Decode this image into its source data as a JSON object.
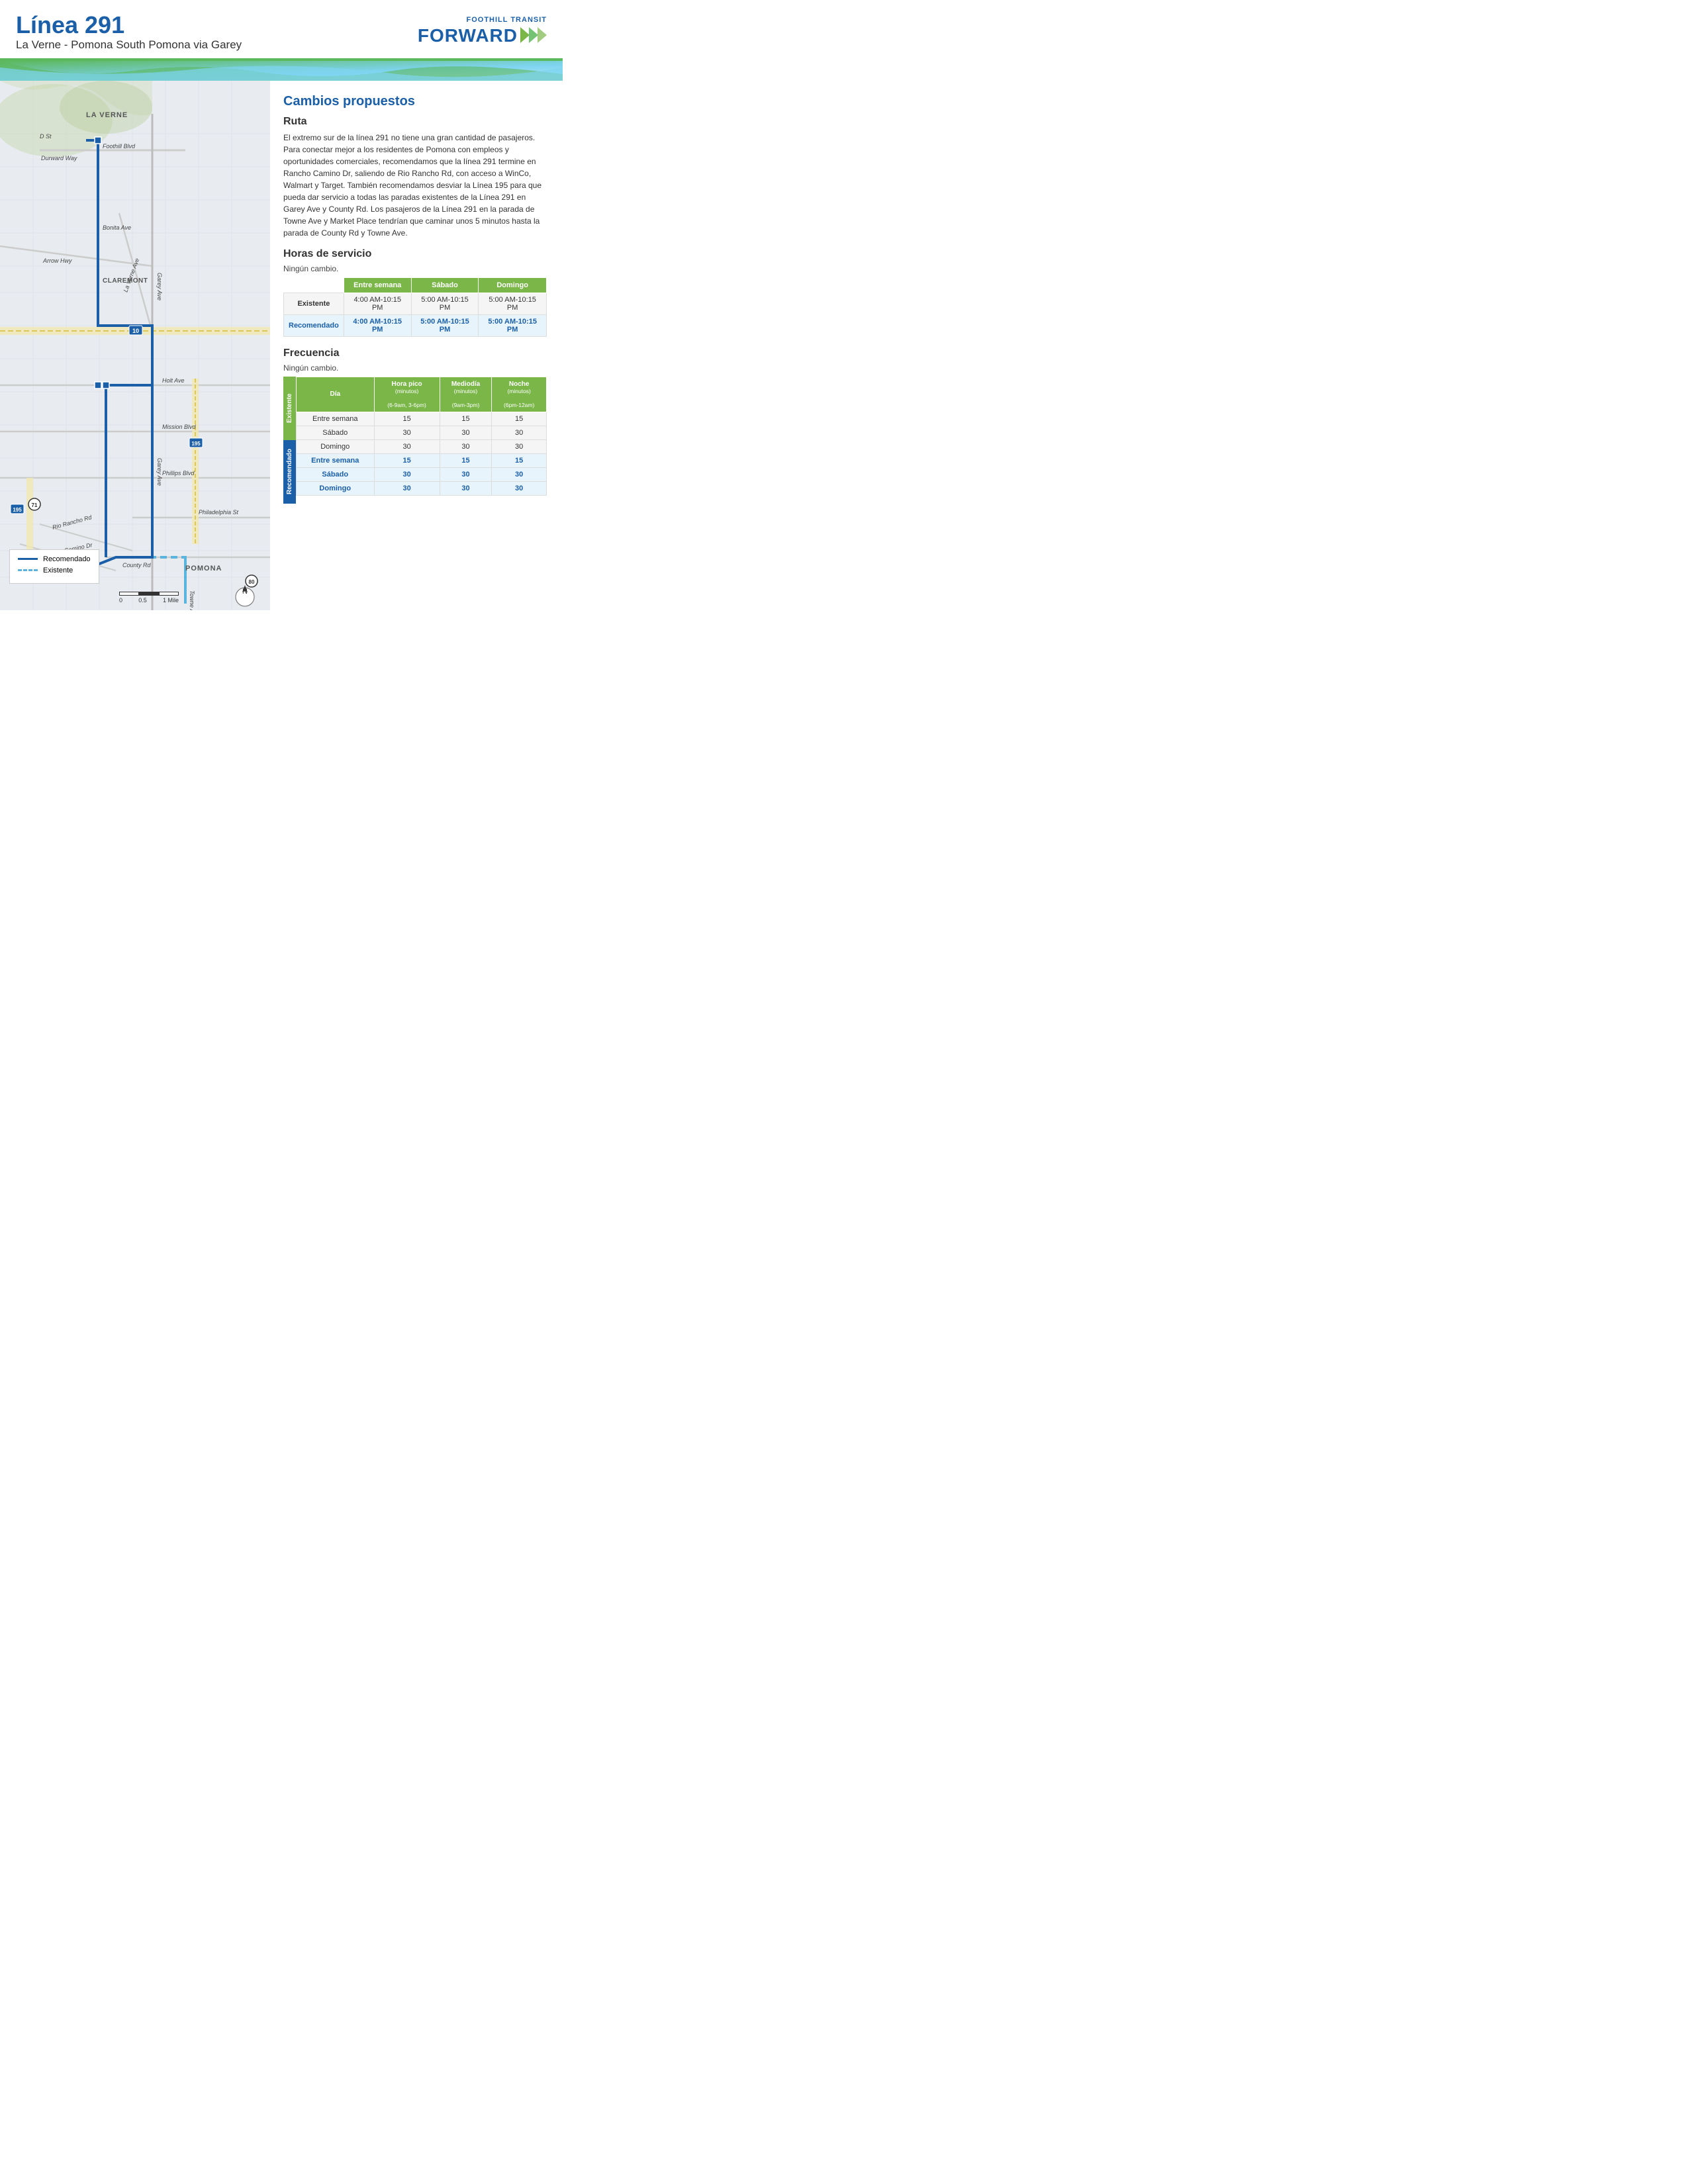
{
  "header": {
    "title": "Línea 291",
    "subtitle": "La Verne - Pomona South Pomona via Garey",
    "logo_top": "FOOTHILL TRANSIT",
    "logo_bottom": "FORWARD"
  },
  "changes": {
    "section_title": "Cambios propuestos",
    "route_title": "Ruta",
    "route_body": "El extremo sur de la línea 291 no tiene una gran cantidad de pasajeros. Para conectar mejor a los residentes de Pomona con empleos y oportunidades comerciales, recomendamos que la línea 291 termine en Rancho Camino Dr, saliendo de Rio Rancho Rd, con acceso a WinCo, Walmart y Target. También recomendamos desviar la Línea 195 para que pueda dar servicio a todas las paradas existentes de la Línea 291 en Garey Ave y County Rd. Los pasajeros de la Línea 291 en la parada de Towne Ave y Market Place tendrían que caminar unos 5 minutos hasta la parada de County Rd y Towne Ave.",
    "service_title": "Horas de servicio",
    "service_no_change": "Ningún cambio.",
    "service_table": {
      "headers": [
        "",
        "Entre semana",
        "Sábado",
        "Domingo"
      ],
      "rows": [
        {
          "label": "Existente",
          "type": "existente",
          "values": [
            "4:00 AM-10:15 PM",
            "5:00 AM-10:15 PM",
            "5:00 AM-10:15 PM"
          ]
        },
        {
          "label": "Recomendado",
          "type": "recomendado",
          "values": [
            "4:00 AM-10:15 PM",
            "5:00 AM-10:15 PM",
            "5:00 AM-10:15 PM"
          ]
        }
      ]
    },
    "freq_title": "Frecuencia",
    "freq_no_change": "Ningún cambio.",
    "freq_table": {
      "headers": [
        "Día",
        "Hora pico\n(minutos)\n(6-9am, 3-6pm)",
        "Mediodía\n(minutos)\n(9am-3pm)",
        "Noche\n(minutos)\n(6pm-12am)"
      ],
      "header_sub": [
        "",
        "(6-9am, 3-6pm)",
        "(9am-3pm)",
        "(6pm-12am)"
      ],
      "existente_rows": [
        {
          "dia": "Entre semana",
          "pico": "15",
          "medio": "15",
          "noche": "15"
        },
        {
          "dia": "Sábado",
          "pico": "30",
          "medio": "30",
          "noche": "30"
        },
        {
          "dia": "Domingo",
          "pico": "30",
          "medio": "30",
          "noche": "30"
        }
      ],
      "recomendado_rows": [
        {
          "dia": "Entre semana",
          "pico": "15",
          "medio": "15",
          "noche": "15"
        },
        {
          "dia": "Sábado",
          "pico": "30",
          "medio": "30",
          "noche": "30"
        },
        {
          "dia": "Domingo",
          "pico": "30",
          "medio": "30",
          "noche": "30"
        }
      ]
    }
  },
  "map": {
    "labels": {
      "la_verne": "LA VERNE",
      "claremont": "CLAREMONT",
      "pomona": "POMONA"
    },
    "roads": {
      "foothill_blvd": "Foothill Blvd",
      "durward_way": "Durward Way",
      "d_st": "D St",
      "bonita_ave": "Bonita Ave",
      "arrow_hwy": "Arrow Hwy",
      "la_verne_ave": "La Verne Ave",
      "garey_ave": "Garey Ave",
      "holt_ave": "Holt Ave",
      "mission_blvd": "Mission Blvd",
      "phillips_blvd": "Phillips Blvd",
      "philadelphia_st": "Philadelphia St",
      "rio_rancho_rd": "Rio Rancho Rd",
      "rancho_camino_dr": "Rancho Camino Dr",
      "county_rd": "County Rd",
      "towne_ave": "Towne Ave"
    },
    "shields": {
      "i10": "10",
      "i71": "71",
      "hwy195_1": "195",
      "hwy195_2": "195",
      "hwy80": "80"
    }
  },
  "legend": {
    "recomendado": "Recomendado",
    "existente": "Existente"
  },
  "scale": {
    "labels": [
      "0",
      "0.5",
      "1 Mile"
    ]
  }
}
